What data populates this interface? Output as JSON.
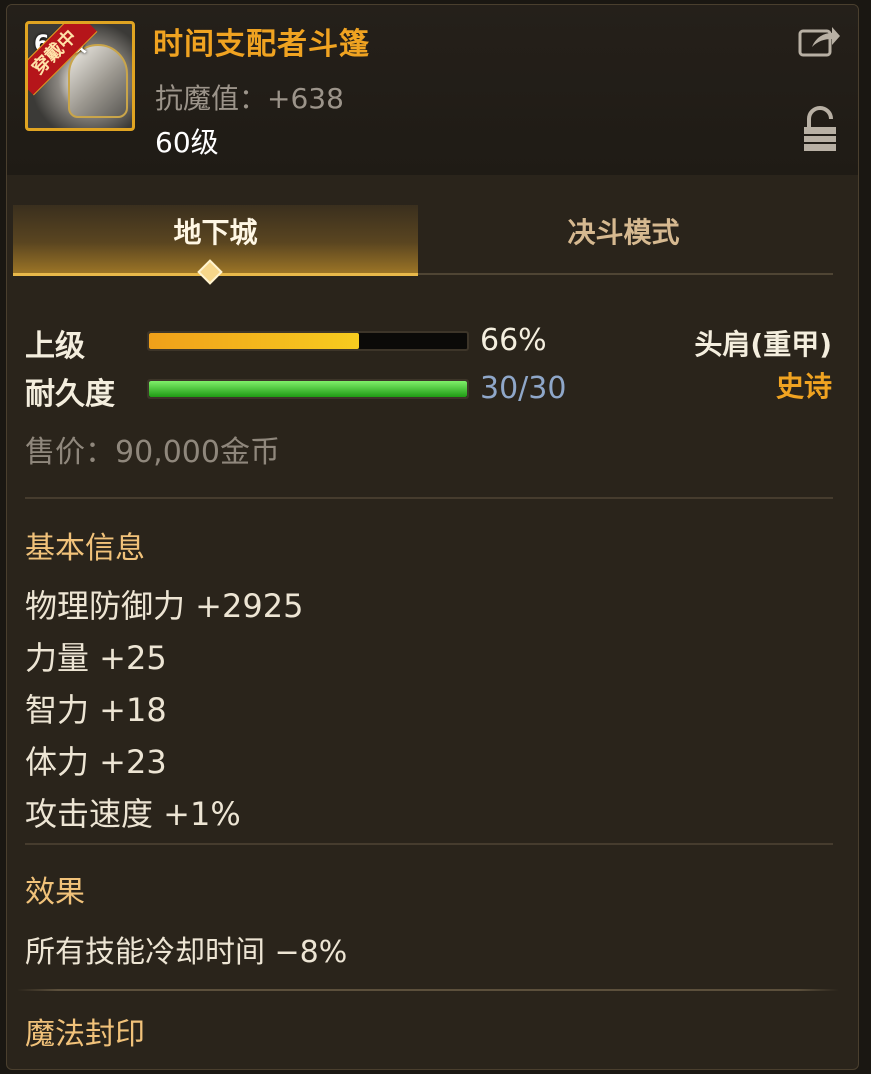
{
  "item": {
    "name": "时间支配者斗篷",
    "resist": "抗魔值：+638",
    "level": "60级",
    "icon_level": "60级",
    "icon_badge": "穿戴中"
  },
  "tabs": [
    {
      "label": "地下城",
      "active": true
    },
    {
      "label": "决斗模式",
      "active": false
    }
  ],
  "upgrade": {
    "label": "上级",
    "percent": "66%",
    "fill": 0.66
  },
  "durability": {
    "label": "耐久度",
    "value": "30/30",
    "fill": 1.0
  },
  "slot": "头肩(重甲)",
  "rarity": "史诗",
  "price": "售价：90,000金币",
  "basic_info": {
    "title": "基本信息",
    "stats": [
      "物理防御力 +2925",
      "力量 +25",
      "智力 +18",
      "体力 +23",
      "攻击速度 +1%"
    ]
  },
  "effects": {
    "title": "效果",
    "lines": [
      "所有技能冷却时间 −8%"
    ]
  },
  "magic_seal": {
    "title": "魔法封印"
  },
  "colors": {
    "name": "#f0a321",
    "rarity_epic": "#f0a321",
    "section_title": "#f1c27a",
    "durability_text": "#8fa7c9"
  },
  "icons": {
    "share": "share-arrow-icon",
    "lock": "lock-icon"
  }
}
